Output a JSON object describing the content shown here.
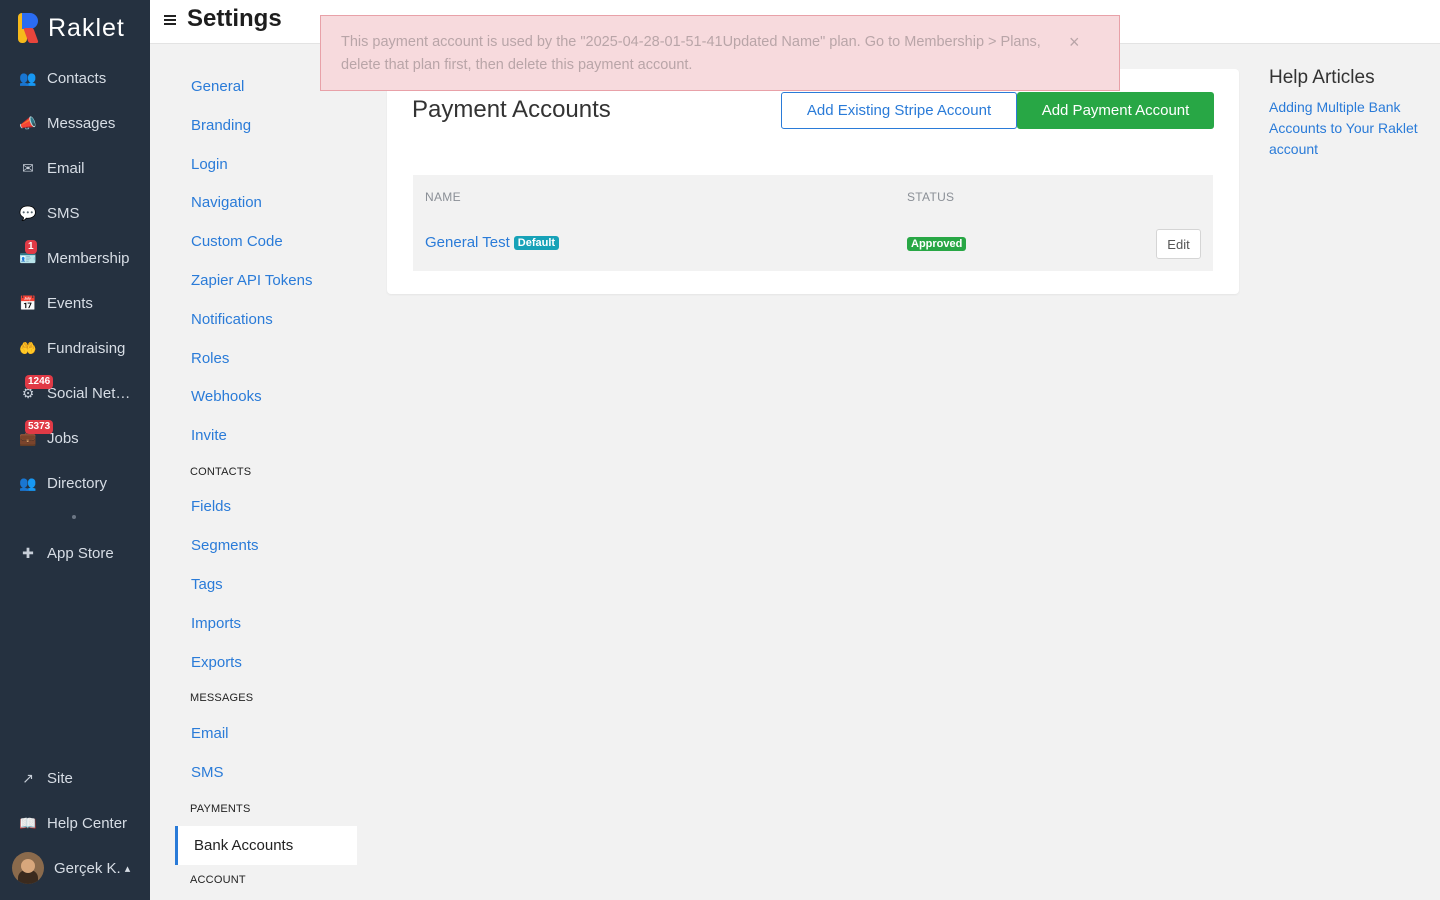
{
  "brand": {
    "name": "Raklet"
  },
  "topbar": {
    "title": "Settings"
  },
  "sidebar": {
    "items": [
      {
        "label": "Contacts",
        "icon": "users-icon",
        "glyph": "👥"
      },
      {
        "label": "Messages",
        "icon": "megaphone-icon",
        "glyph": "📣"
      },
      {
        "label": "Email",
        "icon": "envelope-icon",
        "glyph": "✉"
      },
      {
        "label": "SMS",
        "icon": "sms-icon",
        "glyph": "💬"
      },
      {
        "label": "Membership",
        "icon": "membership-icon",
        "glyph": "🪪",
        "badge": "1"
      },
      {
        "label": "Events",
        "icon": "calendar-icon",
        "glyph": "📅"
      },
      {
        "label": "Fundraising",
        "icon": "donation-icon",
        "glyph": "🤲"
      },
      {
        "label": "Social Network",
        "icon": "social-icon",
        "glyph": "⚙",
        "badge": "1246"
      },
      {
        "label": "Jobs",
        "icon": "briefcase-icon",
        "glyph": "💼",
        "badge": "5373"
      },
      {
        "label": "Directory",
        "icon": "directory-icon",
        "glyph": "👥"
      },
      {
        "label": "App Store",
        "icon": "plus-icon",
        "glyph": "✚"
      }
    ],
    "bottom": [
      {
        "label": "Site",
        "icon": "external-link-icon",
        "glyph": "↗"
      },
      {
        "label": "Help Center",
        "icon": "book-icon",
        "glyph": "📖"
      }
    ],
    "user": {
      "name": "Gerçek K.",
      "caret": "▴"
    }
  },
  "subnav": {
    "links_general": [
      "General",
      "Branding",
      "Login",
      "Navigation",
      "Custom Code",
      "Zapier API Tokens",
      "Notifications",
      "Roles",
      "Webhooks",
      "Invite"
    ],
    "heading_contacts": "CONTACTS",
    "links_contacts": [
      "Fields",
      "Segments",
      "Tags",
      "Imports",
      "Exports"
    ],
    "heading_messages": "MESSAGES",
    "links_messages": [
      "Email",
      "SMS"
    ],
    "heading_payments": "PAYMENTS",
    "active": "Bank Accounts",
    "heading_account": "ACCOUNT"
  },
  "main": {
    "title": "Payment Accounts",
    "add_existing_label": "Add Existing Stripe Account",
    "add_payment_label": "Add Payment Account",
    "table": {
      "col_name": "NAME",
      "col_status": "STATUS",
      "rows": [
        {
          "name": "General Test",
          "tag": "Default",
          "status": "Approved",
          "action": "Edit"
        }
      ]
    }
  },
  "help": {
    "title": "Help Articles",
    "link": "Adding Multiple Bank Accounts to Your Raklet account"
  },
  "alert": {
    "text": "This payment account is used by the \"2025-04-28-01-51-41Updated Name\" plan. Go to Membership > Plans, delete that plan first, then delete this payment account.",
    "close": "×"
  },
  "colors": {
    "sidebar": "#253140",
    "link": "#2a7bd8",
    "success": "#28a745",
    "info": "#17a2b8",
    "danger": "#e03a46"
  }
}
